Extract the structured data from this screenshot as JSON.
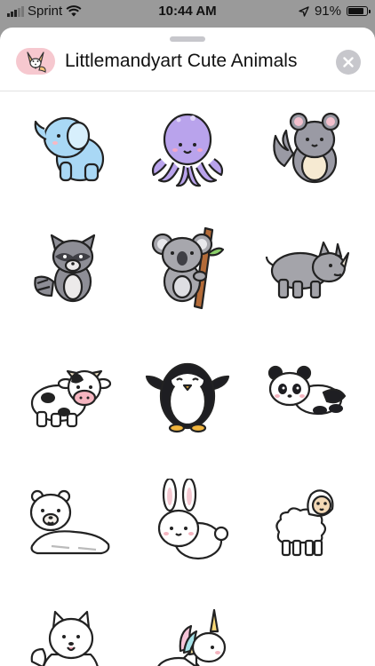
{
  "status_bar": {
    "carrier": "Sprint",
    "time": "10:44 AM",
    "battery_percent_text": "91%",
    "battery_level": 0.91
  },
  "sheet": {
    "title": "Littlemandyart Cute Animals",
    "app_icon": "fox-sticker-icon",
    "close_icon": "close-icon"
  },
  "stickers": [
    {
      "name": "elephant",
      "icon": "elephant-sticker"
    },
    {
      "name": "octopus",
      "icon": "octopus-sticker"
    },
    {
      "name": "chinchilla",
      "icon": "chinchilla-sticker"
    },
    {
      "name": "raccoon",
      "icon": "raccoon-sticker"
    },
    {
      "name": "koala",
      "icon": "koala-sticker"
    },
    {
      "name": "rhino",
      "icon": "rhino-sticker"
    },
    {
      "name": "cow",
      "icon": "cow-sticker"
    },
    {
      "name": "penguin",
      "icon": "penguin-sticker"
    },
    {
      "name": "panda",
      "icon": "panda-sticker"
    },
    {
      "name": "polar bear",
      "icon": "polar-bear-sticker"
    },
    {
      "name": "bunny",
      "icon": "bunny-sticker"
    },
    {
      "name": "alpaca",
      "icon": "alpaca-sticker"
    },
    {
      "name": "samoyed",
      "icon": "samoyed-sticker"
    },
    {
      "name": "unicorn",
      "icon": "unicorn-sticker"
    }
  ]
}
